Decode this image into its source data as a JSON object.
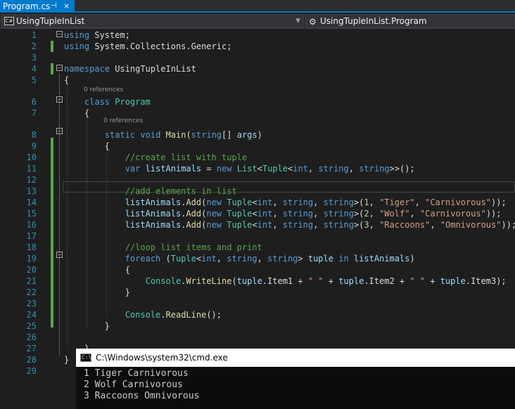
{
  "tab": {
    "title": "Program.cs",
    "pin": "⊣",
    "close": "×"
  },
  "nav": {
    "project": "UsingTupleInList",
    "scope": "UsingTupleInList.Program",
    "project_icon": "C#",
    "class_icon": "class-icon"
  },
  "codelens": {
    "class_refs": "0 references",
    "method_refs": "0 references"
  },
  "lines": [
    {
      "n": "1",
      "html": "<span class='kw'>using</span> System;"
    },
    {
      "n": "2",
      "html": "<span class='kw'>using</span> System.Collections.Generic;"
    },
    {
      "n": "3",
      "html": ""
    },
    {
      "n": "4",
      "html": "<span class='kw'>namespace</span> UsingTupleInList"
    },
    {
      "n": "5",
      "html": "{"
    },
    {
      "n": "6",
      "html": "    <span class='kw'>class</span> <span class='ty'>Program</span>"
    },
    {
      "n": "7",
      "html": "    {"
    },
    {
      "n": "8",
      "html": "        <span class='kw'>static</span> <span class='kw'>void</span> <span class='mt'>Main</span>(<span class='kw'>string</span>[] <span class='vr'>args</span>)"
    },
    {
      "n": "9",
      "html": "        {"
    },
    {
      "n": "10",
      "html": "            <span class='cm'>//create list with tuple</span>"
    },
    {
      "n": "11",
      "html": "            <span class='kw'>var</span> <span class='vr'>listAnimals</span> = <span class='kw'>new</span> <span class='ty'>List</span>&lt;<span class='ty'>Tuple</span>&lt;<span class='kw'>int</span>, <span class='kw'>string</span>, <span class='kw'>string</span>&gt;&gt;();"
    },
    {
      "n": "12",
      "html": ""
    },
    {
      "n": "13",
      "html": "            <span class='cm'>//add elements in list</span>"
    },
    {
      "n": "14",
      "html": "            <span class='vr'>listAnimals</span>.<span class='mt'>Add</span>(<span class='kw'>new</span> <span class='ty'>Tuple</span>&lt;<span class='kw'>int</span>, <span class='kw'>string</span>, <span class='kw'>string</span>&gt;(<span class='nm'>1</span>, <span class='st'>\"Tiger\"</span>, <span class='st'>\"Carnivorous\"</span>));"
    },
    {
      "n": "15",
      "html": "            <span class='vr'>listAnimals</span>.<span class='mt'>Add</span>(<span class='kw'>new</span> <span class='ty'>Tuple</span>&lt;<span class='kw'>int</span>, <span class='kw'>string</span>, <span class='kw'>string</span>&gt;(<span class='nm'>2</span>, <span class='st'>\"Wolf\"</span>, <span class='st'>\"Carnivorous\"</span>));"
    },
    {
      "n": "16",
      "html": "            <span class='vr'>listAnimals</span>.<span class='mt'>Add</span>(<span class='kw'>new</span> <span class='ty'>Tuple</span>&lt;<span class='kw'>int</span>, <span class='kw'>string</span>, <span class='kw'>string</span>&gt;(<span class='nm'>3</span>, <span class='st'>\"Raccoons\"</span>, <span class='st'>\"Omnivorous\"</span>));"
    },
    {
      "n": "17",
      "html": ""
    },
    {
      "n": "18",
      "html": "            <span class='cm'>//loop list items and print</span>"
    },
    {
      "n": "19",
      "html": "            <span class='kw'>foreach</span> (<span class='ty'>Tuple</span>&lt;<span class='kw'>int</span>, <span class='kw'>string</span>, <span class='kw'>string</span>&gt; <span class='vr'>tuple</span> <span class='kw'>in</span> <span class='vr'>listAnimals</span>)"
    },
    {
      "n": "20",
      "html": "            {"
    },
    {
      "n": "21",
      "html": "                <span class='ty'>Console</span>.<span class='mt'>WriteLine</span>(<span class='vr'>tuple</span>.Item1 + <span class='st'>\" \"</span> + <span class='vr'>tuple</span>.Item2 + <span class='st'>\" \"</span> + <span class='vr'>tuple</span>.Item3);"
    },
    {
      "n": "22",
      "html": "            }"
    },
    {
      "n": "23",
      "html": ""
    },
    {
      "n": "24",
      "html": "            <span class='ty'>Console</span>.<span class='mt'>ReadLine</span>();"
    },
    {
      "n": "25",
      "html": "        }"
    },
    {
      "n": "26",
      "html": ""
    },
    {
      "n": "27",
      "html": "    }"
    },
    {
      "n": "28",
      "html": "}"
    },
    {
      "n": "29",
      "html": ""
    }
  ],
  "console": {
    "title": "C:\\Windows\\system32\\cmd.exe",
    "icon": "C:\\",
    "output": [
      "1 Tiger Carnivorous",
      "2 Wolf Carnivorous",
      "3 Raccoons Omnivorous"
    ]
  },
  "colors": {
    "accent": "#007acc",
    "editor_bg": "#1e1e1e",
    "console_bg": "#0c0c0c",
    "change_bar": "#57a64a"
  }
}
